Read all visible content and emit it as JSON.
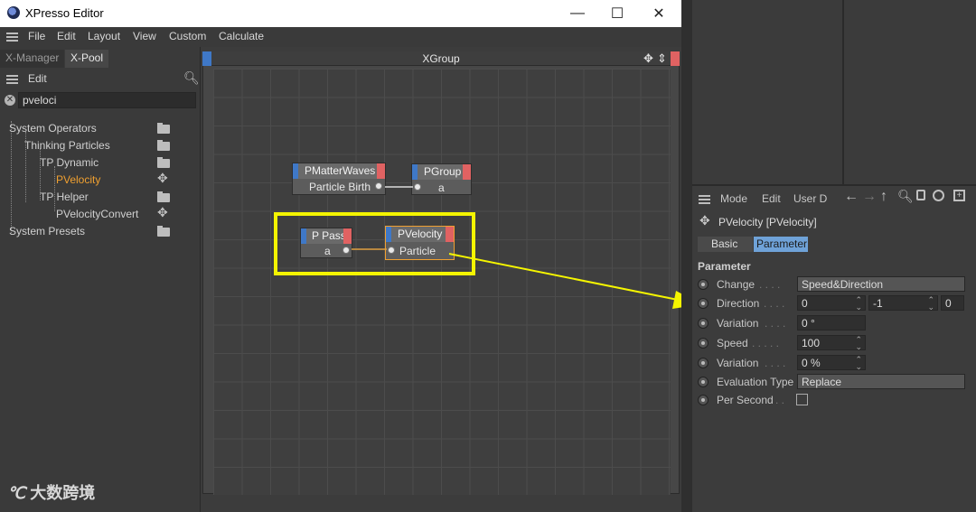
{
  "window": {
    "title": "XPresso Editor",
    "controls": [
      "—",
      "☐",
      "✕"
    ]
  },
  "menubar": {
    "items": [
      "File",
      "Edit",
      "Layout",
      "View",
      "Custom",
      "Calculate"
    ]
  },
  "left_panel": {
    "tabs": [
      "X-Manager",
      "X-Pool"
    ],
    "edit_label": "Edit",
    "search_value": "pveloci",
    "tree": [
      {
        "label": "System Operators",
        "type": "folder"
      },
      {
        "label": "Thinking Particles",
        "type": "folder"
      },
      {
        "label": "TP Dynamic",
        "type": "folder"
      },
      {
        "label": "PVelocity",
        "type": "node",
        "selected": true
      },
      {
        "label": "TP Helper",
        "type": "folder"
      },
      {
        "label": "PVelocityConvert",
        "type": "node"
      },
      {
        "label": "System Presets",
        "type": "folder"
      }
    ]
  },
  "xgroup": {
    "title": "XGroup",
    "nodes": {
      "pmatterwaves": {
        "title": "PMatterWaves",
        "port": "Particle Birth"
      },
      "pgroup": {
        "title": "PGroup",
        "port": "a"
      },
      "ppass": {
        "title": "P Pass",
        "port": "a"
      },
      "pvelocity": {
        "title": "PVelocity",
        "port": "Particle"
      }
    }
  },
  "attributes": {
    "menu": [
      "Mode",
      "Edit",
      "User D"
    ],
    "object_title": "PVelocity [PVelocity]",
    "tabs": [
      "Basic",
      "Parameter"
    ],
    "section": "Parameter",
    "params": {
      "change": {
        "label": "Change",
        "value": "Speed&Direction"
      },
      "direction": {
        "label": "Direction",
        "x": "0",
        "y": "-1",
        "z": "0"
      },
      "variation1": {
        "label": "Variation",
        "value": "0 °"
      },
      "speed": {
        "label": "Speed",
        "value": "100"
      },
      "variation2": {
        "label": "Variation",
        "value": "0 %"
      },
      "evaluation": {
        "label": "Evaluation Type",
        "value": "Replace"
      },
      "per_second": {
        "label": "Per Second",
        "checked": false
      }
    }
  },
  "watermark": {
    "text": "大数跨境"
  },
  "colors": {
    "highlight": "#f5f500",
    "node_blue": "#3f78c7",
    "node_red": "#e06262",
    "selected_text": "#f0a030"
  }
}
